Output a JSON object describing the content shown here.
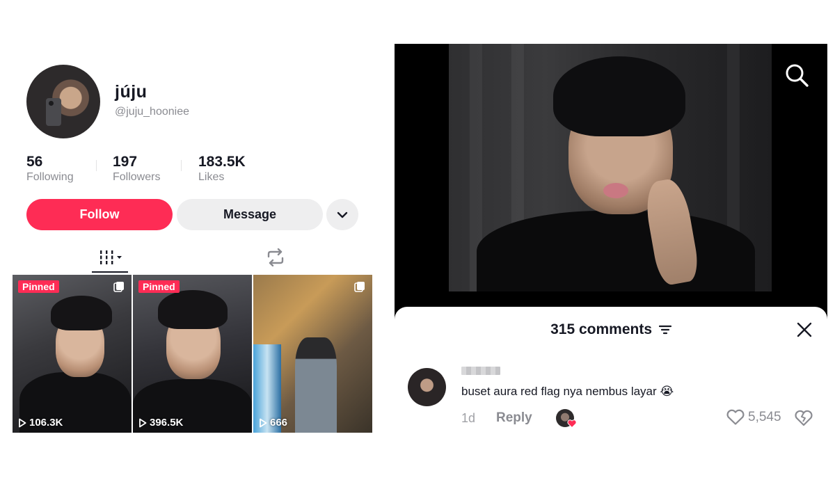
{
  "profile": {
    "name": "júju",
    "handle": "@juju_hooniee",
    "stats": [
      {
        "value": "56",
        "label": "Following"
      },
      {
        "value": "197",
        "label": "Followers"
      },
      {
        "value": "183.5K",
        "label": "Likes"
      }
    ],
    "follow_label": "Follow",
    "message_label": "Message",
    "accent_color": "#fe2c55"
  },
  "tabs": [
    {
      "icon": "videos-grid-icon",
      "active": true
    },
    {
      "icon": "repost-icon",
      "active": false
    }
  ],
  "videos": [
    {
      "pinned_label": "Pinned",
      "views": "106.3K",
      "multi_icon": "carousel-icon"
    },
    {
      "pinned_label": "Pinned",
      "views": "396.5K",
      "multi_icon": ""
    },
    {
      "pinned_label": "",
      "views": "666",
      "multi_icon": "carousel-icon"
    }
  ],
  "video_player": {
    "search_icon": "search-icon"
  },
  "comments_sheet": {
    "title": "315 comments",
    "comment": {
      "text": "buset aura red flag nya nembus layar 😭",
      "time": "1d",
      "reply_label": "Reply",
      "like_count": "5,545"
    }
  }
}
